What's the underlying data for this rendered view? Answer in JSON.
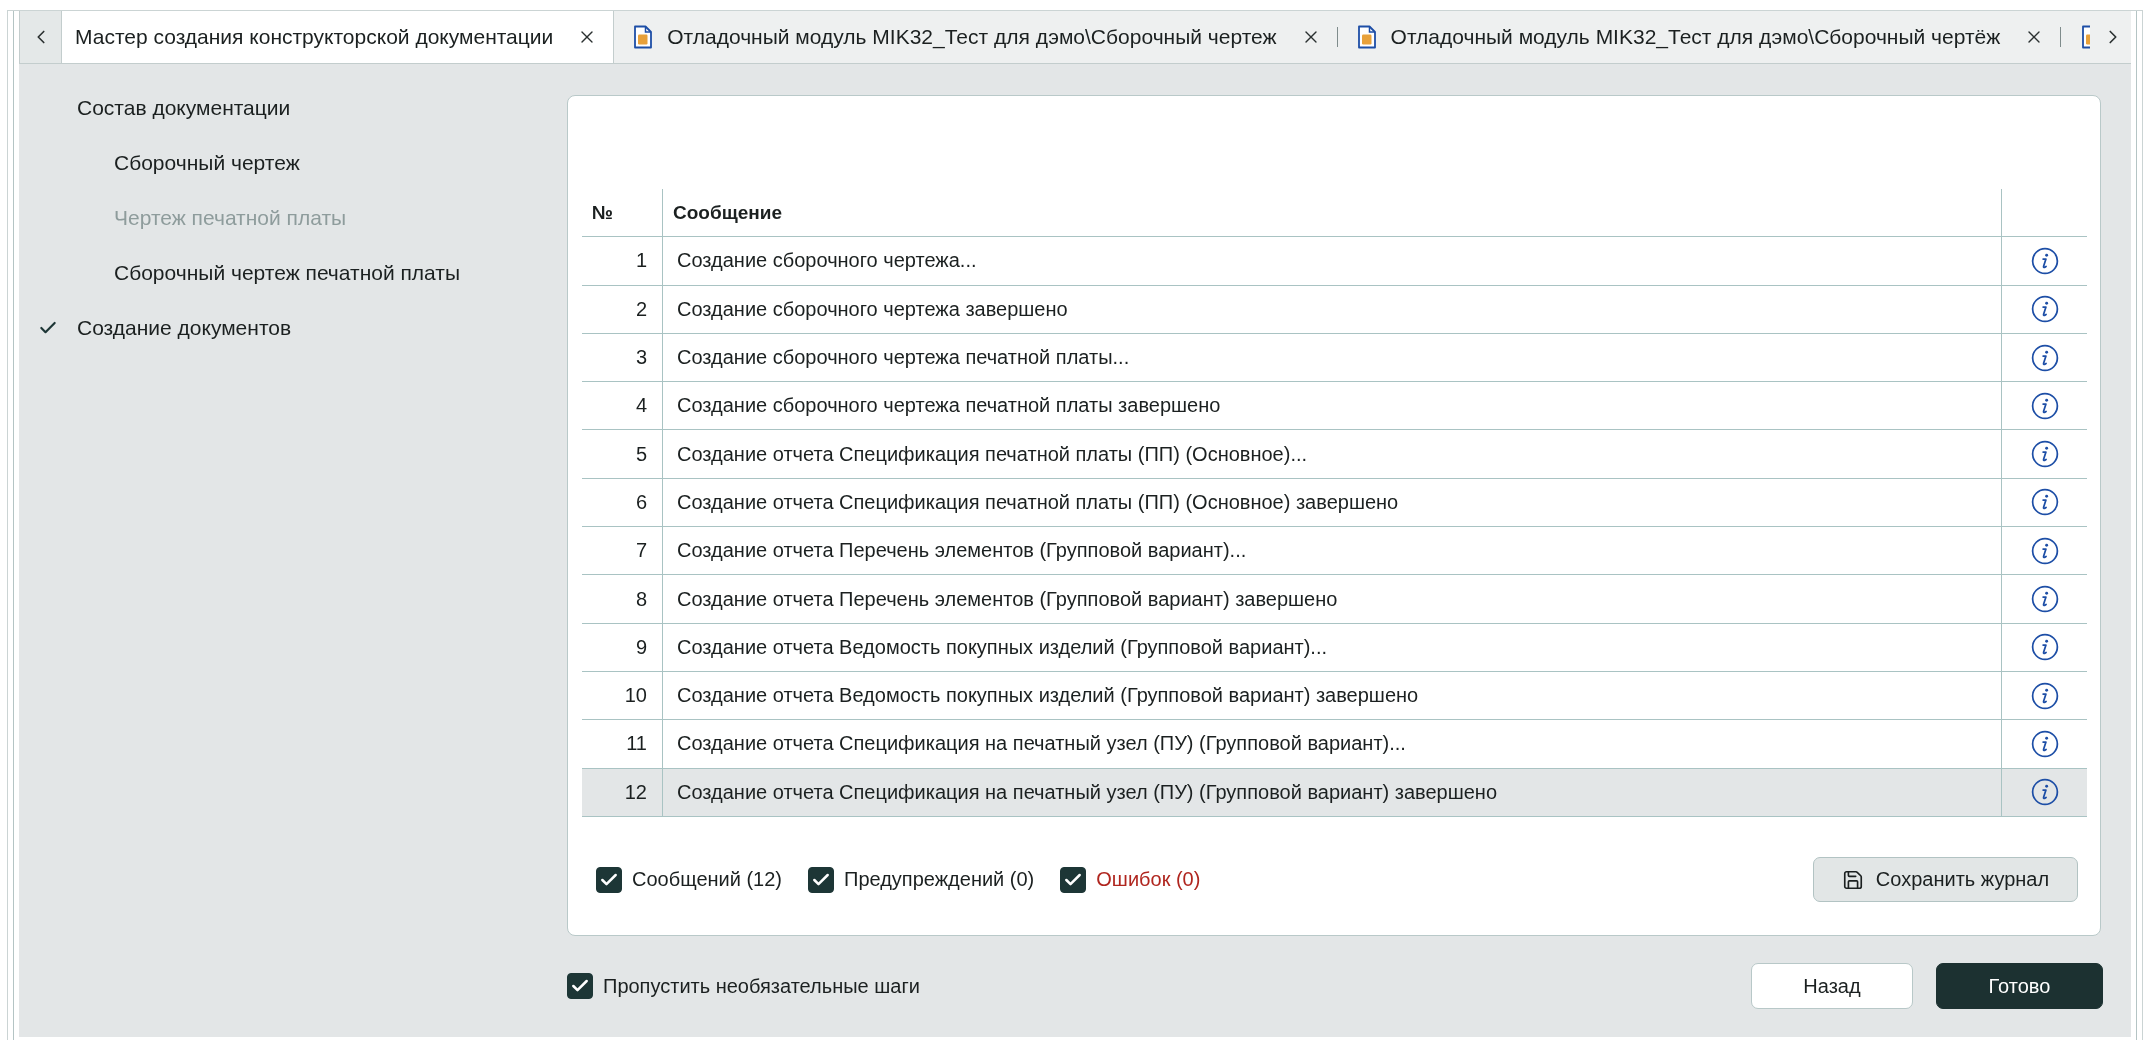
{
  "tabs": [
    {
      "label": "Мастер создания конструкторской документации",
      "selected": true,
      "kind": "wizard"
    },
    {
      "label": "Отладочный модуль MIK32_Тест для дэмо\\Сборочный чертеж",
      "selected": false,
      "kind": "document"
    },
    {
      "label": "Отладочный модуль MIK32_Тест для дэмо\\Сборочный чертёж",
      "selected": false,
      "kind": "document"
    }
  ],
  "steps": [
    {
      "label": "Состав документации",
      "selected": false,
      "disabled": false,
      "children": [
        {
          "label": "Сборочный чертеж",
          "selected": false,
          "disabled": false
        },
        {
          "label": "Чертеж печатной платы",
          "selected": false,
          "disabled": true
        },
        {
          "label": "Сборочный чертеж печатной платы",
          "selected": false,
          "disabled": false
        }
      ]
    },
    {
      "label": "Создание документов",
      "selected": true,
      "disabled": false
    }
  ],
  "log_table": {
    "columns": [
      "№",
      "Сообщение"
    ],
    "rows": [
      {
        "number": "1",
        "message": "Создание сборочного чертежа...",
        "selected": false
      },
      {
        "number": "2",
        "message": "Создание сборочного чертежа завершено",
        "selected": false
      },
      {
        "number": "3",
        "message": "Создание сборочного чертежа печатной платы...",
        "selected": false
      },
      {
        "number": "4",
        "message": "Создание сборочного чертежа печатной платы завершено",
        "selected": false
      },
      {
        "number": "5",
        "message": "Создание отчета Спецификация печатной платы (ПП) (Основное)...",
        "selected": false
      },
      {
        "number": "6",
        "message": "Создание отчета Спецификация печатной платы (ПП) (Основное) завершено",
        "selected": false
      },
      {
        "number": "7",
        "message": "Создание отчета Перечень элементов (Групповой вариант)...",
        "selected": false
      },
      {
        "number": "8",
        "message": "Создание отчета Перечень элементов (Групповой вариант) завершено",
        "selected": false
      },
      {
        "number": "9",
        "message": "Создание отчета Ведомость покупных изделий (Групповой вариант)...",
        "selected": false
      },
      {
        "number": "10",
        "message": "Создание отчета Ведомость покупных изделий (Групповой вариант) завершено",
        "selected": false
      },
      {
        "number": "11",
        "message": "Создание отчета Спецификация на печатный узел (ПУ) (Групповой вариант)...",
        "selected": false
      },
      {
        "number": "12",
        "message": "Создание отчета Спецификация на печатный узел (ПУ) (Групповой вариант) завершено",
        "selected": true
      }
    ]
  },
  "filters": [
    {
      "label": "Сообщений (12)",
      "checked": true,
      "kind": "message"
    },
    {
      "label": "Предупреждений (0)",
      "checked": true,
      "kind": "warning"
    },
    {
      "label": "Ошибок (0)",
      "checked": true,
      "kind": "error"
    }
  ],
  "save_log_button": {
    "label": "Сохранить журнал"
  },
  "skip_optional": {
    "label": "Пропустить необязательные шаги",
    "checked": true
  },
  "buttons": [
    {
      "label": "Назад",
      "kind": "secondary"
    },
    {
      "label": "Готово",
      "kind": "primary"
    }
  ]
}
